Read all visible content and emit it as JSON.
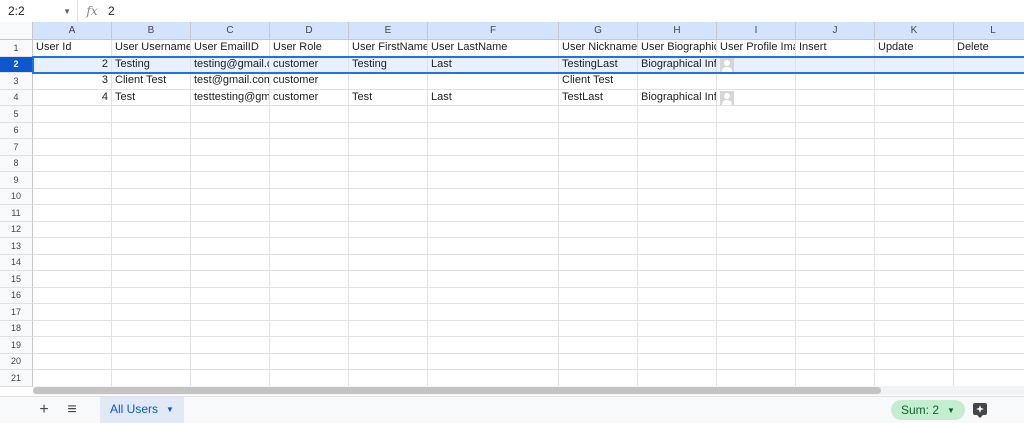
{
  "formula_bar": {
    "cell_ref": "2:2",
    "fx": "fx",
    "value": "2"
  },
  "columns": [
    "A",
    "B",
    "C",
    "D",
    "E",
    "F",
    "G",
    "H",
    "I",
    "J",
    "K",
    "L"
  ],
  "row_numbers": [
    "1",
    "2",
    "3",
    "4",
    "5",
    "6",
    "7",
    "8",
    "9",
    "10",
    "11",
    "12",
    "13",
    "14",
    "15",
    "16",
    "17",
    "18",
    "19",
    "20",
    "21"
  ],
  "header_row": [
    "User Id",
    "User Username",
    "User EmailID",
    "User Role",
    "User FirstName",
    "User LastName",
    "User Nickname",
    "User Biographical Info",
    "User Profile Image",
    "Insert",
    "Update",
    "Delete"
  ],
  "data_rows": [
    [
      "2",
      "Testing",
      "testing@gmail.com",
      "customer",
      "Testing",
      "Last",
      "TestingLast",
      "Biographical Info",
      "avatar",
      "",
      "",
      ""
    ],
    [
      "3",
      "Client Test",
      "test@gmail.com",
      "customer",
      "",
      "",
      "Client Test",
      "",
      "",
      "",
      "",
      ""
    ],
    [
      "4",
      "Test",
      "testtesting@gmail.com",
      "customer",
      "Test",
      "Last",
      "TestLast",
      "Biographical Info",
      "avatar",
      "",
      "",
      ""
    ]
  ],
  "bottom": {
    "add_icon": "+",
    "sheets_menu_icon": "≡",
    "sheet_tab": "All Users",
    "sum_label": "Sum: 2"
  },
  "colors": {
    "accent": "#1a73e8",
    "header_bg": "#d3e3fd",
    "sum_bg": "#c4eed0"
  }
}
